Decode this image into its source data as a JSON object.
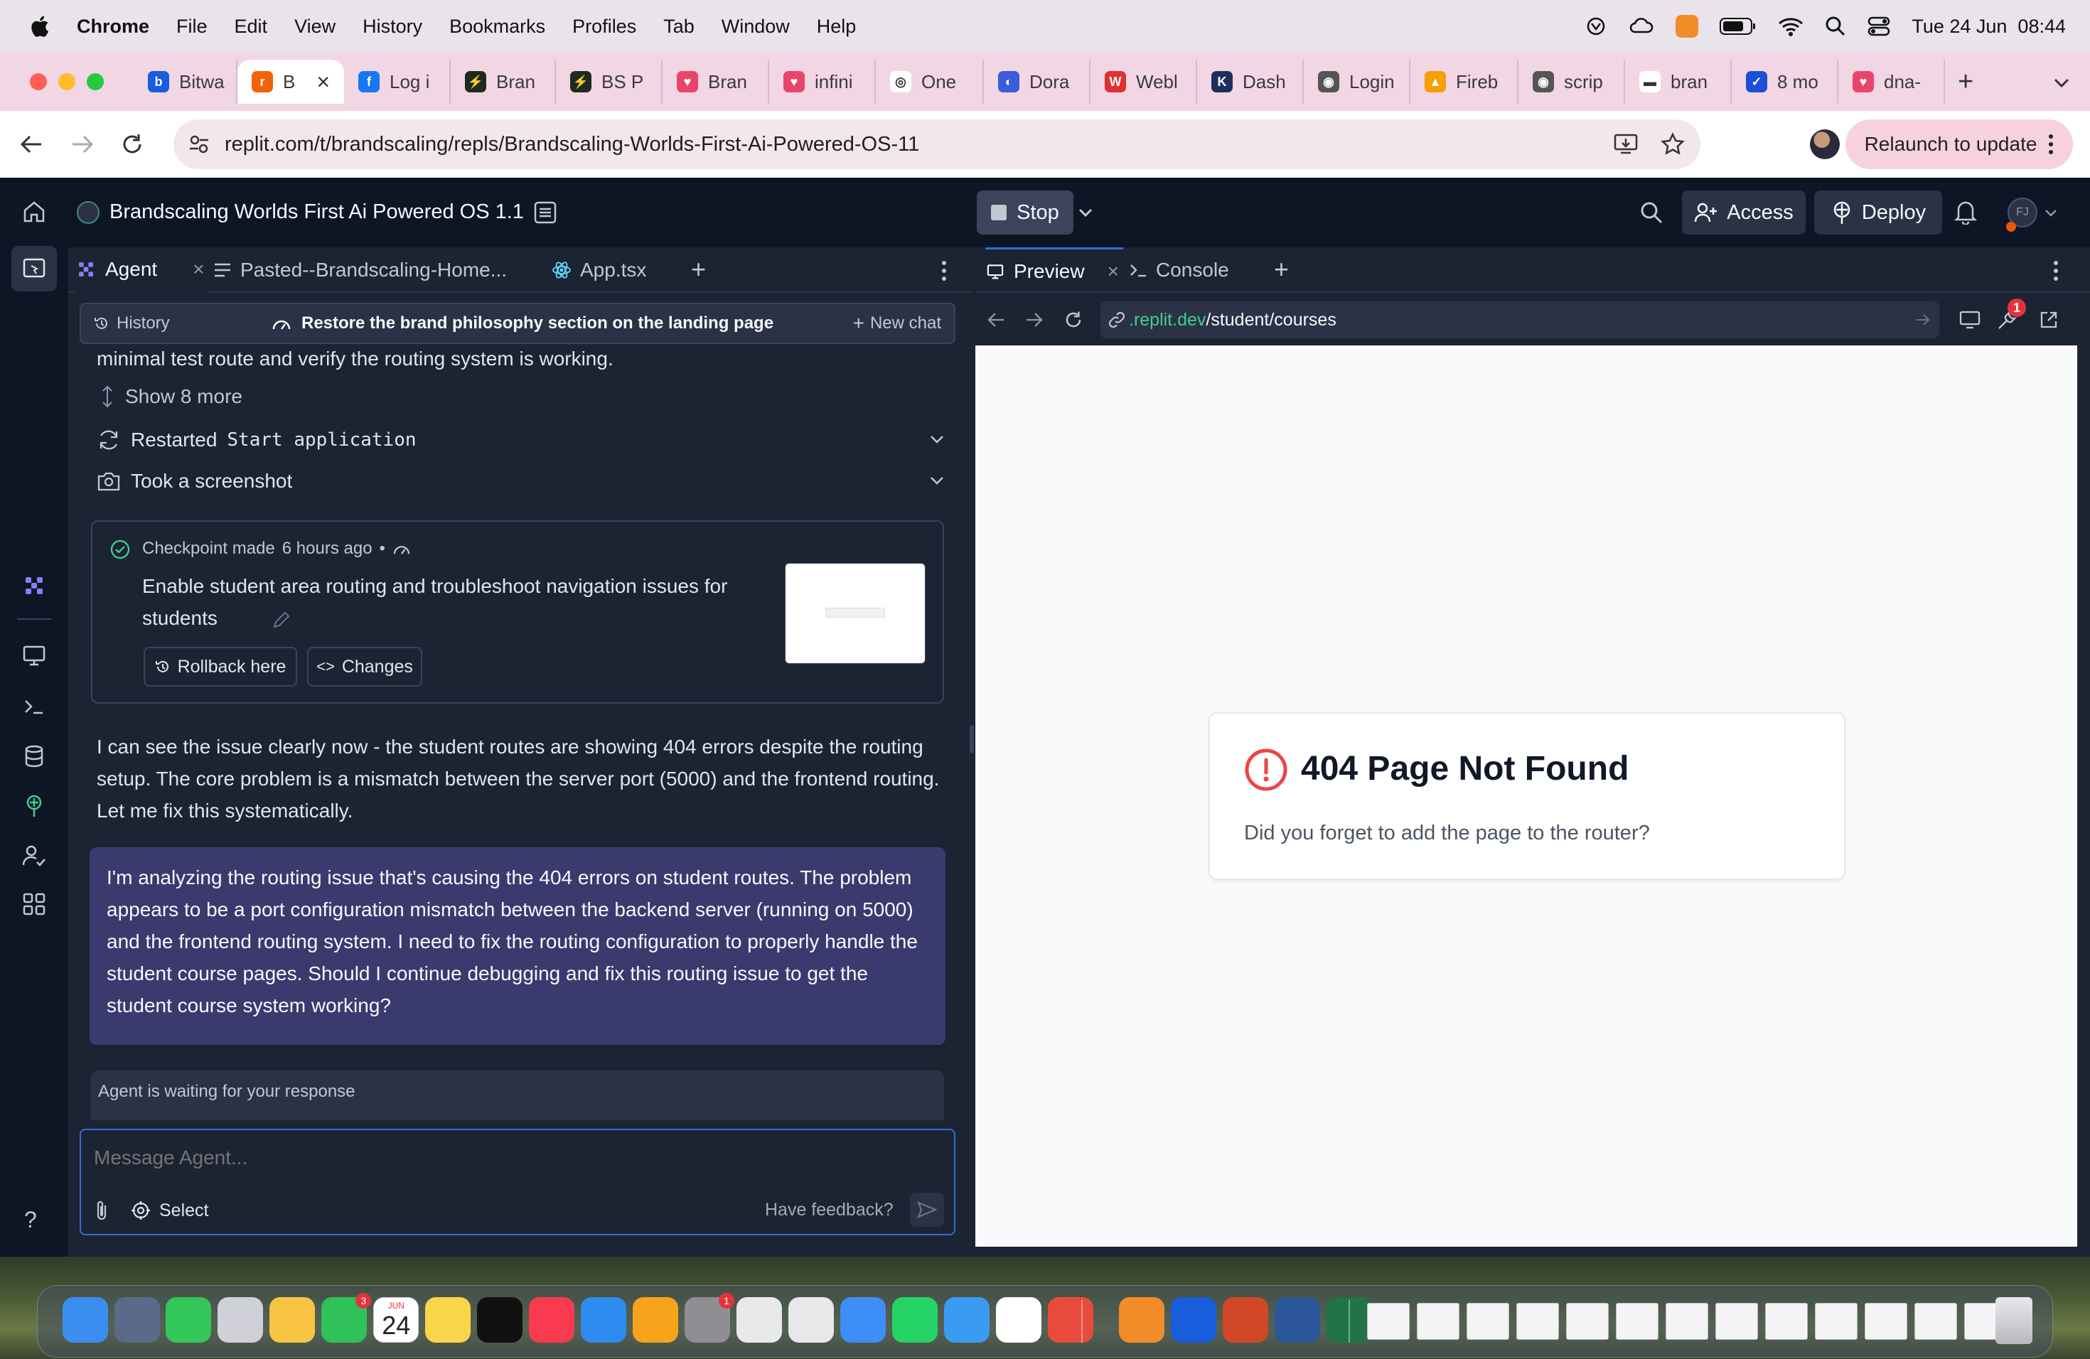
{
  "menubar": {
    "app_name": "Chrome",
    "items": [
      "File",
      "Edit",
      "View",
      "History",
      "Bookmarks",
      "Profiles",
      "Tab",
      "Window",
      "Help"
    ],
    "clock": "Tue 24 Jun  08:44"
  },
  "browser_tabs": [
    {
      "label": "Bitwa",
      "color": "#175ddc",
      "glyph": "b"
    },
    {
      "label": "B",
      "color": "#f26207",
      "glyph": "r",
      "active": true
    },
    {
      "label": "Log i",
      "color": "#1877f2",
      "glyph": "f"
    },
    {
      "label": "Bran",
      "color": "#1e2b1e",
      "glyph": "⚡"
    },
    {
      "label": "BS P",
      "color": "#1e2b1e",
      "glyph": "⚡"
    },
    {
      "label": "Bran",
      "color": "#e8456b",
      "glyph": "♥"
    },
    {
      "label": "infini",
      "color": "#e8456b",
      "glyph": "♥"
    },
    {
      "label": "One",
      "color": "#ffffff",
      "glyph": "◎"
    },
    {
      "label": "Dora",
      "color": "#3b5bdb",
      "glyph": "◐"
    },
    {
      "label": "Webl",
      "color": "#e03131",
      "glyph": "W"
    },
    {
      "label": "Dash",
      "color": "#1f2d5c",
      "glyph": "K"
    },
    {
      "label": "Login",
      "color": "#555555",
      "glyph": "◉"
    },
    {
      "label": "Fireb",
      "color": "#f59f00",
      "glyph": "▲"
    },
    {
      "label": "scrip",
      "color": "#555555",
      "glyph": "◉"
    },
    {
      "label": "bran",
      "color": "#ffffff",
      "glyph": "▬"
    },
    {
      "label": "8 mo",
      "color": "#1d4ed8",
      "glyph": "✓"
    },
    {
      "label": "dna-",
      "color": "#e8456b",
      "glyph": "♥"
    }
  ],
  "address": {
    "url": "replit.com/t/brandscaling/repls/Brandscaling-Worlds-First-Ai-Powered-OS-11",
    "relaunch_label": "Relaunch to update"
  },
  "replit": {
    "project_name": "Brandscaling Worlds First Ai Powered OS 1.1",
    "stop_label": "Stop",
    "access_label": "Access",
    "deploy_label": "Deploy",
    "avatar_initials": "FJ",
    "left_tabs": [
      "Agent",
      "Pasted--Brandscaling-Home...",
      "App.tsx"
    ],
    "right_tabs": [
      "Preview",
      "Console"
    ],
    "history_label": "History",
    "chat_title": "Restore the brand philosophy section on the landing page",
    "new_chat_label": "New chat",
    "truncated_line": "minimal test route and verify the routing system is working.",
    "show_more": "Show 8 more",
    "restarted_prefix": "Restarted",
    "restarted_target": "Start application",
    "screenshot_label": "Took a screenshot",
    "checkpoint": {
      "prefix": "Checkpoint made",
      "time": "6 hours ago",
      "description": "Enable student area routing and troubleshoot navigation issues for students",
      "rollback_label": "Rollback here",
      "changes_label": "Changes"
    },
    "agent_message": "I can see the issue clearly now - the student routes are showing 404 errors despite the routing setup. The core problem is a mismatch between the server port (5000) and the frontend routing. Let me fix this systematically.",
    "agent_question": "I'm analyzing the routing issue that's causing the 404 errors on student routes. The problem appears to be a port configuration mismatch between the backend server (running on 5000) and the frontend routing system. I need to fix the routing configuration to properly handle the student course pages. Should I continue debugging and fix this routing issue to get the student course system working?",
    "waiting_label": "Agent is waiting for your response",
    "input_placeholder": "Message Agent...",
    "select_label": "Select",
    "feedback_label": "Have feedback?",
    "preview_domain": ".replit.dev",
    "preview_path": "/student/courses",
    "devtools_badge": "1",
    "error_title": "404 Page Not Found",
    "error_body": "Did you forget to add the page to the router?"
  },
  "dock": {
    "calendar_month": "JUN",
    "calendar_day": "24",
    "facetime_badge": "3",
    "settings_badge": "1"
  },
  "colors": {
    "replit_bg": "#1c2333",
    "replit_dark": "#0e1525",
    "accent_purple": "#7c6cf0",
    "tab_strip": "#f3d6e3"
  }
}
